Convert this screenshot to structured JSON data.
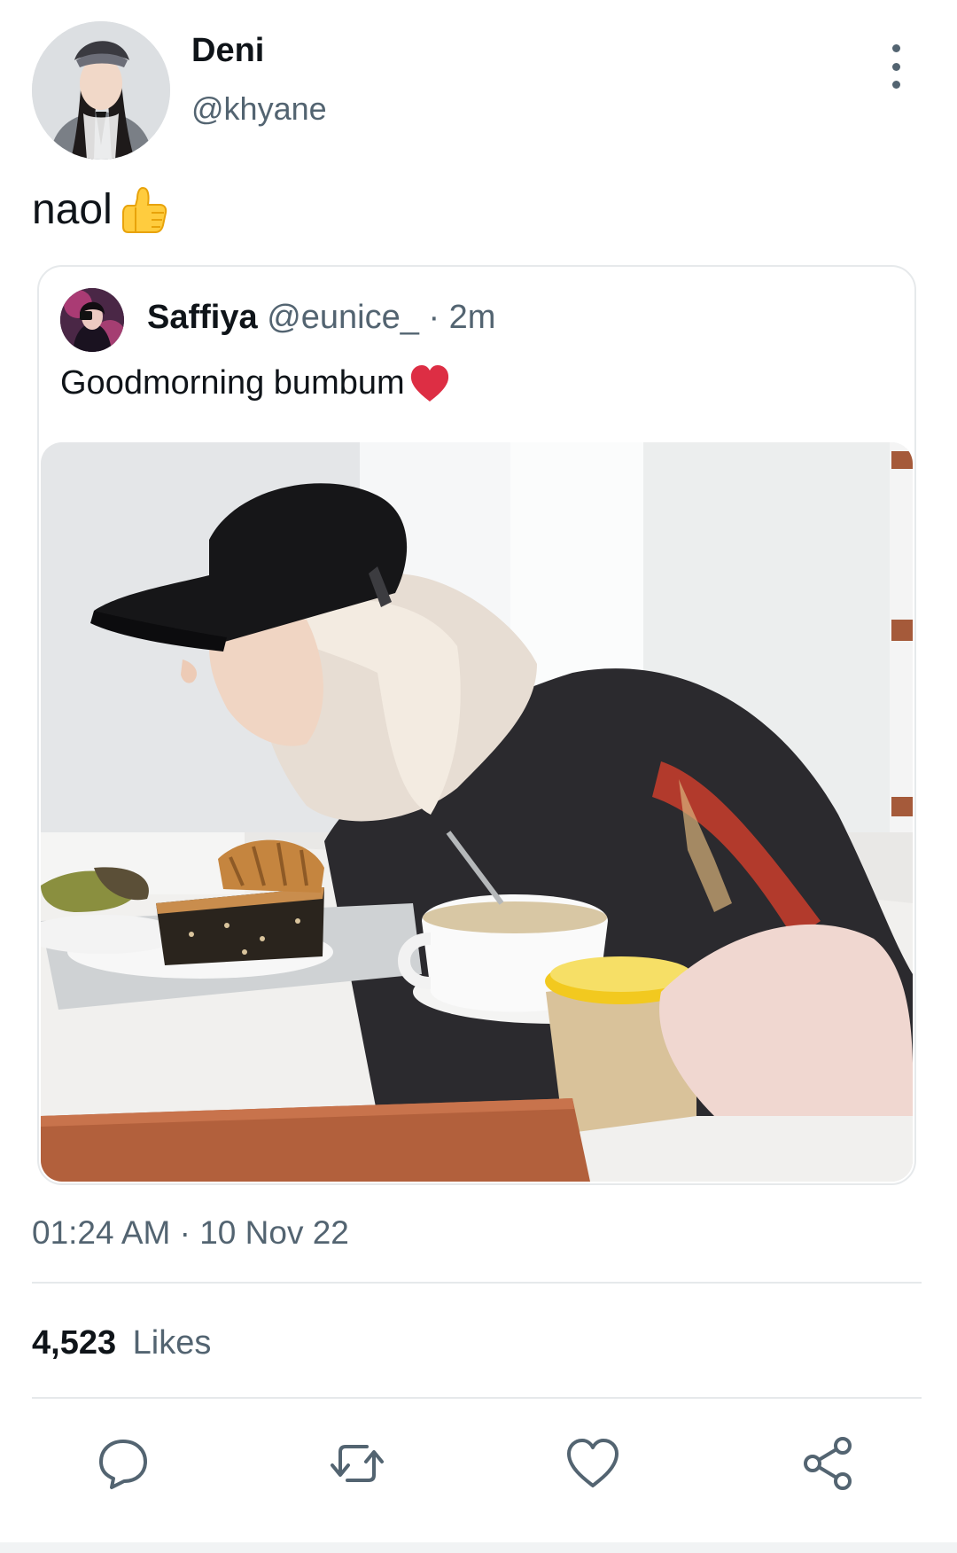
{
  "author": {
    "display_name": "Deni",
    "handle": "@khyane"
  },
  "tweet": {
    "text": "naol",
    "emoji": "thumbs-up",
    "timestamp": "01:24 AM · 10 Nov 22",
    "likes_count": "4,523",
    "likes_label": "Likes"
  },
  "quoted_tweet": {
    "display_name": "Saffiya",
    "handle": "@eunice_",
    "separator": "·",
    "time": "2m",
    "text": "Goodmorning bumbum",
    "emoji": "red-heart"
  },
  "actions": [
    {
      "name": "reply",
      "icon": "reply-icon"
    },
    {
      "name": "retweet",
      "icon": "retweet-icon"
    },
    {
      "name": "like",
      "icon": "heart-icon"
    },
    {
      "name": "share",
      "icon": "share-icon"
    }
  ],
  "colors": {
    "text_primary": "#0f1419",
    "text_secondary": "#536471",
    "border": "#e6e9eb",
    "icon": "#536471"
  }
}
